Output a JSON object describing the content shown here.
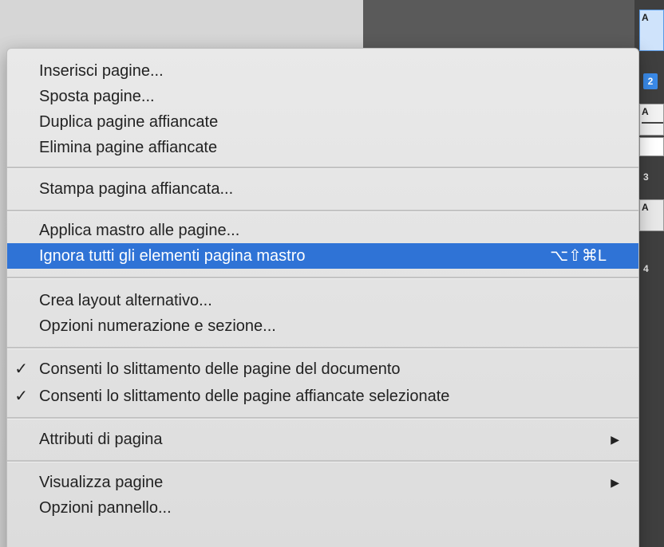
{
  "menu": {
    "items": [
      {
        "label": "Inserisci pagine...",
        "checked": false
      },
      {
        "label": "Sposta pagine...",
        "checked": false
      },
      {
        "label": "Duplica pagine affiancate",
        "checked": false
      },
      {
        "label": "Elimina pagine affiancate",
        "checked": false
      },
      {
        "label": "Stampa pagina affiancata...",
        "checked": false
      },
      {
        "label": "Applica mastro alle pagine...",
        "checked": false
      },
      {
        "label": "Ignora tutti gli elementi pagina mastro",
        "shortcut": "⌥⇧⌘L",
        "highlighted": true
      },
      {
        "label": "Crea layout alternativo...",
        "checked": false
      },
      {
        "label": "Opzioni numerazione e sezione...",
        "checked": false
      },
      {
        "label": "Consenti lo slittamento delle pagine del documento",
        "check_mark": "✓"
      },
      {
        "label": "Consenti lo slittamento delle pagine affiancate selezionate",
        "check_mark": "✓"
      },
      {
        "label": "Attributi di pagina",
        "submenu_arrow": "▶"
      },
      {
        "label": "Visualizza pagine",
        "submenu_arrow": "▶"
      },
      {
        "label": "Opzioni pannello..."
      }
    ]
  },
  "pages_panel": {
    "page_numbers": [
      "2",
      "3",
      "4"
    ],
    "master_labels": [
      "A",
      "A",
      "A"
    ]
  },
  "colors": {
    "highlight": "#2f73d6",
    "menu_bg": "#e4e4e4",
    "dark_panel": "#5a5a5a",
    "page_selected": "#3a8ae8"
  }
}
